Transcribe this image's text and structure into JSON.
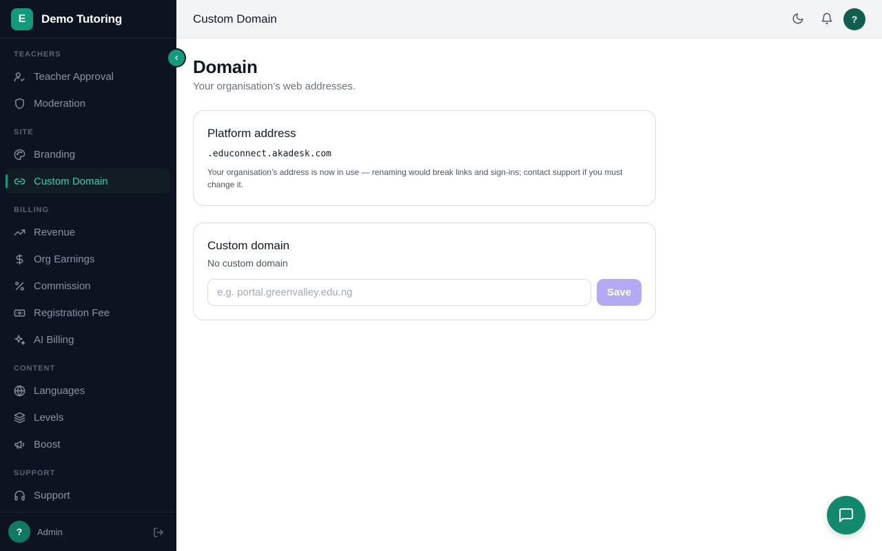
{
  "brand": {
    "logo_letter": "E",
    "name": "Demo Tutoring"
  },
  "sidebar": {
    "sections": [
      {
        "label": "TEACHERS"
      },
      {
        "label": "SITE"
      },
      {
        "label": "BILLING"
      },
      {
        "label": "CONTENT"
      },
      {
        "label": "SUPPORT"
      }
    ],
    "items": [
      {
        "label": "Teacher Approval",
        "icon": "user-check-icon"
      },
      {
        "label": "Moderation",
        "icon": "shield-icon"
      },
      {
        "label": "Branding",
        "icon": "palette-icon"
      },
      {
        "label": "Custom Domain",
        "icon": "link-icon",
        "active": true
      },
      {
        "label": "Revenue",
        "icon": "trending-up-icon"
      },
      {
        "label": "Org Earnings",
        "icon": "dollar-icon"
      },
      {
        "label": "Commission",
        "icon": "percent-icon"
      },
      {
        "label": "Registration Fee",
        "icon": "banknote-icon"
      },
      {
        "label": "AI Billing",
        "icon": "sparkles-icon"
      },
      {
        "label": "Languages",
        "icon": "globe-icon"
      },
      {
        "label": "Levels",
        "icon": "layers-icon"
      },
      {
        "label": "Boost",
        "icon": "megaphone-icon"
      },
      {
        "label": "Support",
        "icon": "headphones-icon"
      }
    ],
    "footer": {
      "avatar_text": "?",
      "user_label": "Admin"
    }
  },
  "header": {
    "title": "Custom Domain",
    "avatar_text": "?"
  },
  "main": {
    "title": "Domain",
    "subtitle": "Your organisation’s web addresses.",
    "platform_card": {
      "title": "Platform address",
      "address": ".educonnect.akadesk.com",
      "note": "Your organisation’s address is now in use — renaming would break links and sign-ins; contact support if you must change it."
    },
    "custom_card": {
      "title": "Custom domain",
      "status": "No custom domain",
      "input_value": "",
      "input_placeholder": "e.g. portal.greenvalley.edu.ng",
      "save_label": "Save"
    }
  },
  "colors": {
    "accent": "#119a7c",
    "sidebar_bg": "#0d1321",
    "active_text": "#34d3a3",
    "save_button_bg": "#b3aaf3"
  }
}
